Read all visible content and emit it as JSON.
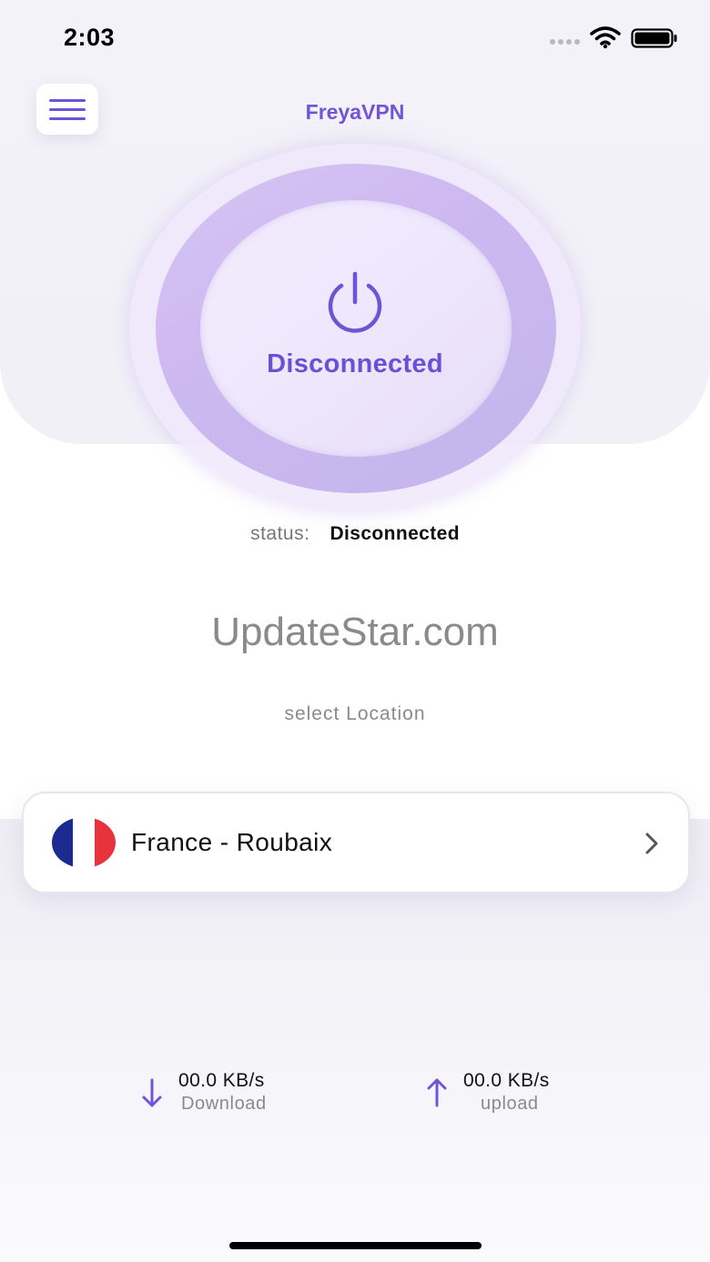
{
  "status_bar": {
    "time": "2:03"
  },
  "header": {
    "app_title": "FreyaVPN"
  },
  "connect_button": {
    "label": "Disconnected"
  },
  "status": {
    "key": "status:",
    "value": "Disconnected"
  },
  "watermark": "UpdateStar.com",
  "location": {
    "section_label": "select Location",
    "selected": "France - Roubaix",
    "flag_colors": [
      "#1d2a8f",
      "#ffffff",
      "#e8323c"
    ]
  },
  "stats": {
    "download": {
      "value": "00.0 KB/s",
      "label": "Download"
    },
    "upload": {
      "value": "00.0 KB/s",
      "label": "upload"
    }
  },
  "colors": {
    "accent": "#6b55d6",
    "ring": "#cdb8f0"
  },
  "icons": {
    "menu": "hamburger-menu-icon",
    "power": "power-icon",
    "chevron": "chevron-right-icon",
    "download": "arrow-down-icon",
    "upload": "arrow-up-icon"
  }
}
